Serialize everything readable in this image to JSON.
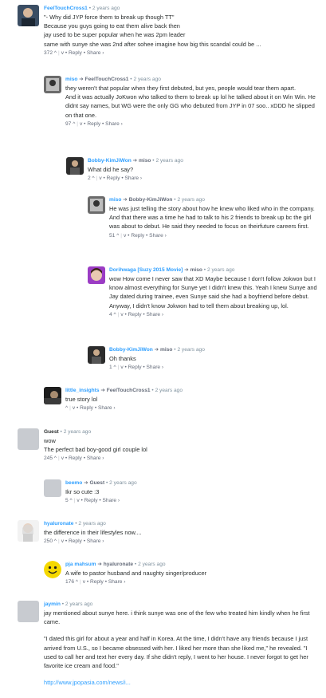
{
  "comments": [
    {
      "author": "FeelTouchCross1",
      "reply_to": "",
      "time": "2 years ago",
      "lines": [
        "\"- Why did JYP force them to break up though TT\"",
        "Because you guys going to eat them alive back then",
        "jay used to be super popular when he was 2pm leader",
        "same with sunye she was 2nd after sohee imagine how big this scandal could be ..."
      ],
      "votes": "372",
      "reply": "Reply",
      "share": "Share ›"
    },
    {
      "author": "miso",
      "reply_to": "FeelTouchCross1",
      "time": "2 years ago",
      "lines": [
        "they weren't that popular when they first debuted, but yes, people would tear them apart.",
        "And it was actually JoKwon who talked to them to break up lol he talked about it on Win Win. He didnt say names, but WG were the only GG who debuted from JYP in 07 soo.. xDDD he slipped on that one."
      ],
      "votes": "97",
      "reply": "Reply",
      "share": "Share ›"
    },
    {
      "author": "Bobby-KimJiWon",
      "reply_to": "miso",
      "time": "2 years ago",
      "lines": [
        "What did he say?"
      ],
      "votes": "2",
      "reply": "Reply",
      "share": "Share ›"
    },
    {
      "author": "miso",
      "reply_to": "Bobby-KimJiWon",
      "time": "2 years ago",
      "lines": [
        "He was just telling the story about how he knew who liked who in the company. And that there was a time he had to talk to his 2 friends to break up bc the girl was about to debut. He said they needed to focus on theirfuture careers first."
      ],
      "votes": "51",
      "reply": "Reply",
      "share": "Share ›"
    },
    {
      "author": "Dorihwaga [Suzy 2015 Movie]",
      "reply_to": "miso",
      "time": "2 years ago",
      "lines": [
        "wow How come I never saw that XD Maybe because I don't follow Jokwon but I know almost everything for Sunye yet I didn't knew this. Yeah I knew Sunye and Jay dated during trainee, even Sunye said she had a boyfriend before debut. Anyway, I didn't know Jokwon had to tell them about breaking up, lol."
      ],
      "votes": "4",
      "reply": "Reply",
      "share": "Share ›"
    },
    {
      "author": "Bobby-KimJiWon",
      "reply_to": "miso",
      "time": "2 years ago",
      "lines": [
        "Oh thanks"
      ],
      "votes": "1",
      "reply": "Reply",
      "share": "Share ›"
    },
    {
      "author": "little_insights",
      "reply_to": "FeelTouchCross1",
      "time": "2 years ago",
      "lines": [
        "true story lol"
      ],
      "votes": "",
      "reply": "Reply",
      "share": "Share ›"
    },
    {
      "author": "Guest",
      "reply_to": "",
      "time": "2 years ago",
      "lines": [
        "wow",
        "The perfect bad boy-good girl couple lol"
      ],
      "votes": "245",
      "reply": "Reply",
      "share": "Share ›"
    },
    {
      "author": "beemo",
      "reply_to": "Guest",
      "time": "2 years ago",
      "lines": [
        "Ikr so cute :3"
      ],
      "votes": "5",
      "reply": "Reply",
      "share": "Share ›"
    },
    {
      "author": "hyaluronate",
      "reply_to": "",
      "time": "2 years ago",
      "lines": [
        "the difference in their lifestyles now...."
      ],
      "votes": "250",
      "reply": "Reply",
      "share": "Share ›"
    },
    {
      "author": "pja mahsum",
      "reply_to": "hyaluronate",
      "time": "2 years ago",
      "lines": [
        "A wife to pastor husband and naughty singer/producer"
      ],
      "votes": "176",
      "reply": "Reply",
      "share": "Share ›"
    },
    {
      "author": "jaymin",
      "reply_to": "",
      "time": "2 years ago",
      "lines": [
        "jay mentioned about sunye here. i think sunye was one of the few who treated him kindly when he first came.",
        "\"I dated this girl for about a year and half in Korea. At the time, I didn't have any friends because I just arrived from U.S., so I became obsessed with her. I liked her more than she liked me,\" he revealed. \"I used to call her and text her every day. If she didn't reply, I went to her house. I never forgot to get her favorite ice cream and food.\"",
        "http://www.jpopasia.com/news/i..."
      ],
      "votes": "",
      "reply": "Reply",
      "share": "Share ›"
    }
  ],
  "ui": {
    "dot": "•",
    "arrow": "➔",
    "upvote": "^",
    "downvote": "v"
  },
  "colors": {
    "author": "#2e9fff",
    "meta": "#656c7a",
    "text": "#2a2e2e",
    "guest_avatar": "#c8cbd0"
  },
  "avatars": [
    "photo-avatar",
    "photo-avatar",
    "photo-avatar",
    "photo-avatar",
    "photo-avatar",
    "photo-avatar",
    "photo-avatar",
    "default-avatar",
    "default-avatar",
    "photo-avatar",
    "smiley-avatar",
    "default-avatar"
  ]
}
